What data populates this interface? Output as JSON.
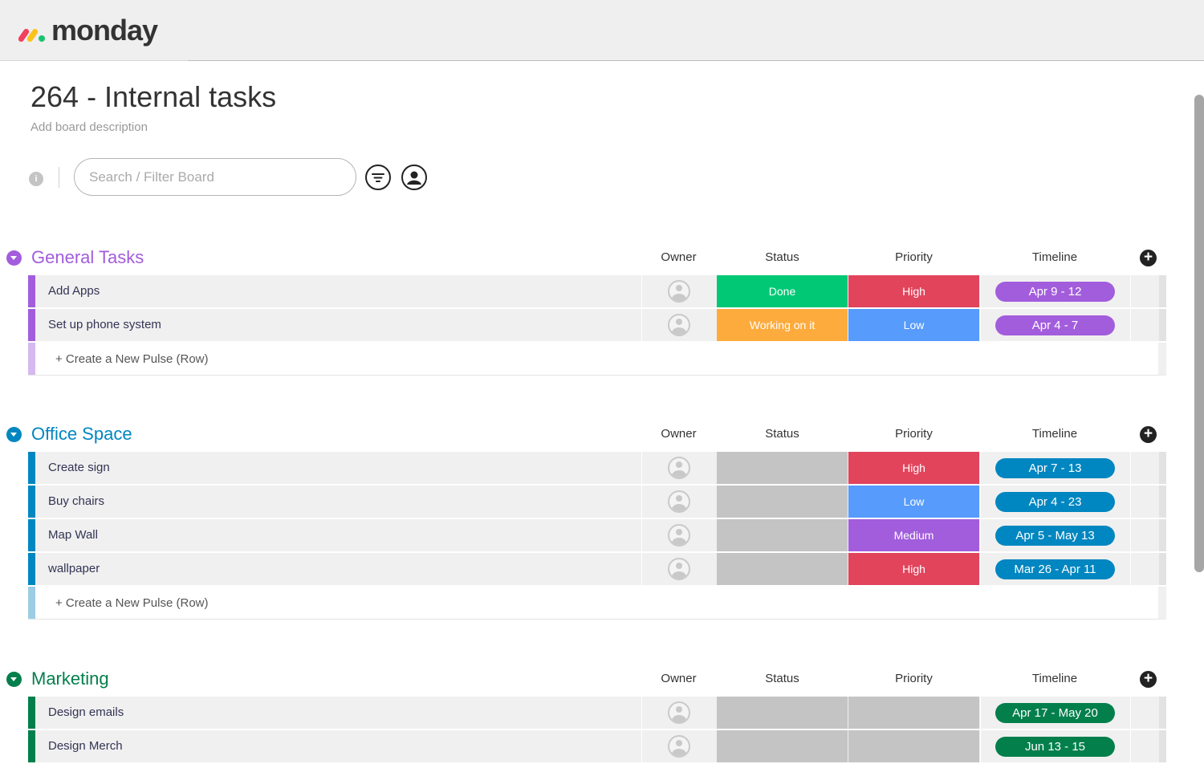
{
  "app": {
    "logo_text": "monday"
  },
  "board": {
    "title": "264 - Internal tasks",
    "description": "Add board description"
  },
  "toolbar": {
    "info_label": "i",
    "search_placeholder": "Search / Filter Board",
    "filter_icon": "filter-icon",
    "person_icon": "person-icon"
  },
  "columns": {
    "owner": "Owner",
    "status": "Status",
    "priority": "Priority",
    "timeline": "Timeline"
  },
  "create_label": "+ Create a New Pulse (Row)",
  "colors": {
    "done": "#00c875",
    "working": "#fdab3d",
    "high": "#e2445c",
    "low": "#579bfc",
    "medium": "#a25ddc",
    "empty": "#c4c4c4"
  },
  "groups": [
    {
      "title": "General Tasks",
      "color": "#a25ddc",
      "light": "#d6b9f0",
      "rows": [
        {
          "name": "Add Apps",
          "status": "Done",
          "status_color": "#00c875",
          "priority": "High",
          "priority_color": "#e2445c",
          "timeline": "Apr 9 - 12"
        },
        {
          "name": "Set up phone system",
          "status": "Working on it",
          "status_color": "#fdab3d",
          "priority": "Low",
          "priority_color": "#579bfc",
          "timeline": "Apr 4 - 7"
        }
      ]
    },
    {
      "title": "Office Space",
      "color": "#0086c0",
      "light": "#9ccde3",
      "rows": [
        {
          "name": "Create sign",
          "status": "",
          "status_color": "#c4c4c4",
          "priority": "High",
          "priority_color": "#e2445c",
          "timeline": "Apr 7 - 13"
        },
        {
          "name": "Buy chairs",
          "status": "",
          "status_color": "#c4c4c4",
          "priority": "Low",
          "priority_color": "#579bfc",
          "timeline": "Apr 4 - 23"
        },
        {
          "name": "Map Wall",
          "status": "",
          "status_color": "#c4c4c4",
          "priority": "Medium",
          "priority_color": "#a25ddc",
          "timeline": "Apr 5 - May 13"
        },
        {
          "name": "wallpaper",
          "status": "",
          "status_color": "#c4c4c4",
          "priority": "High",
          "priority_color": "#e2445c",
          "timeline": "Mar 26 - Apr 11"
        }
      ]
    },
    {
      "title": "Marketing",
      "color": "#037f4c",
      "light": "#9fd1b9",
      "rows": [
        {
          "name": "Design emails",
          "status": "",
          "status_color": "#c4c4c4",
          "priority": "",
          "priority_color": "#c4c4c4",
          "timeline": "Apr 17 - May 20"
        },
        {
          "name": "Design Merch",
          "status": "",
          "status_color": "#c4c4c4",
          "priority": "",
          "priority_color": "#c4c4c4",
          "timeline": "Jun 13 - 15"
        }
      ]
    }
  ]
}
